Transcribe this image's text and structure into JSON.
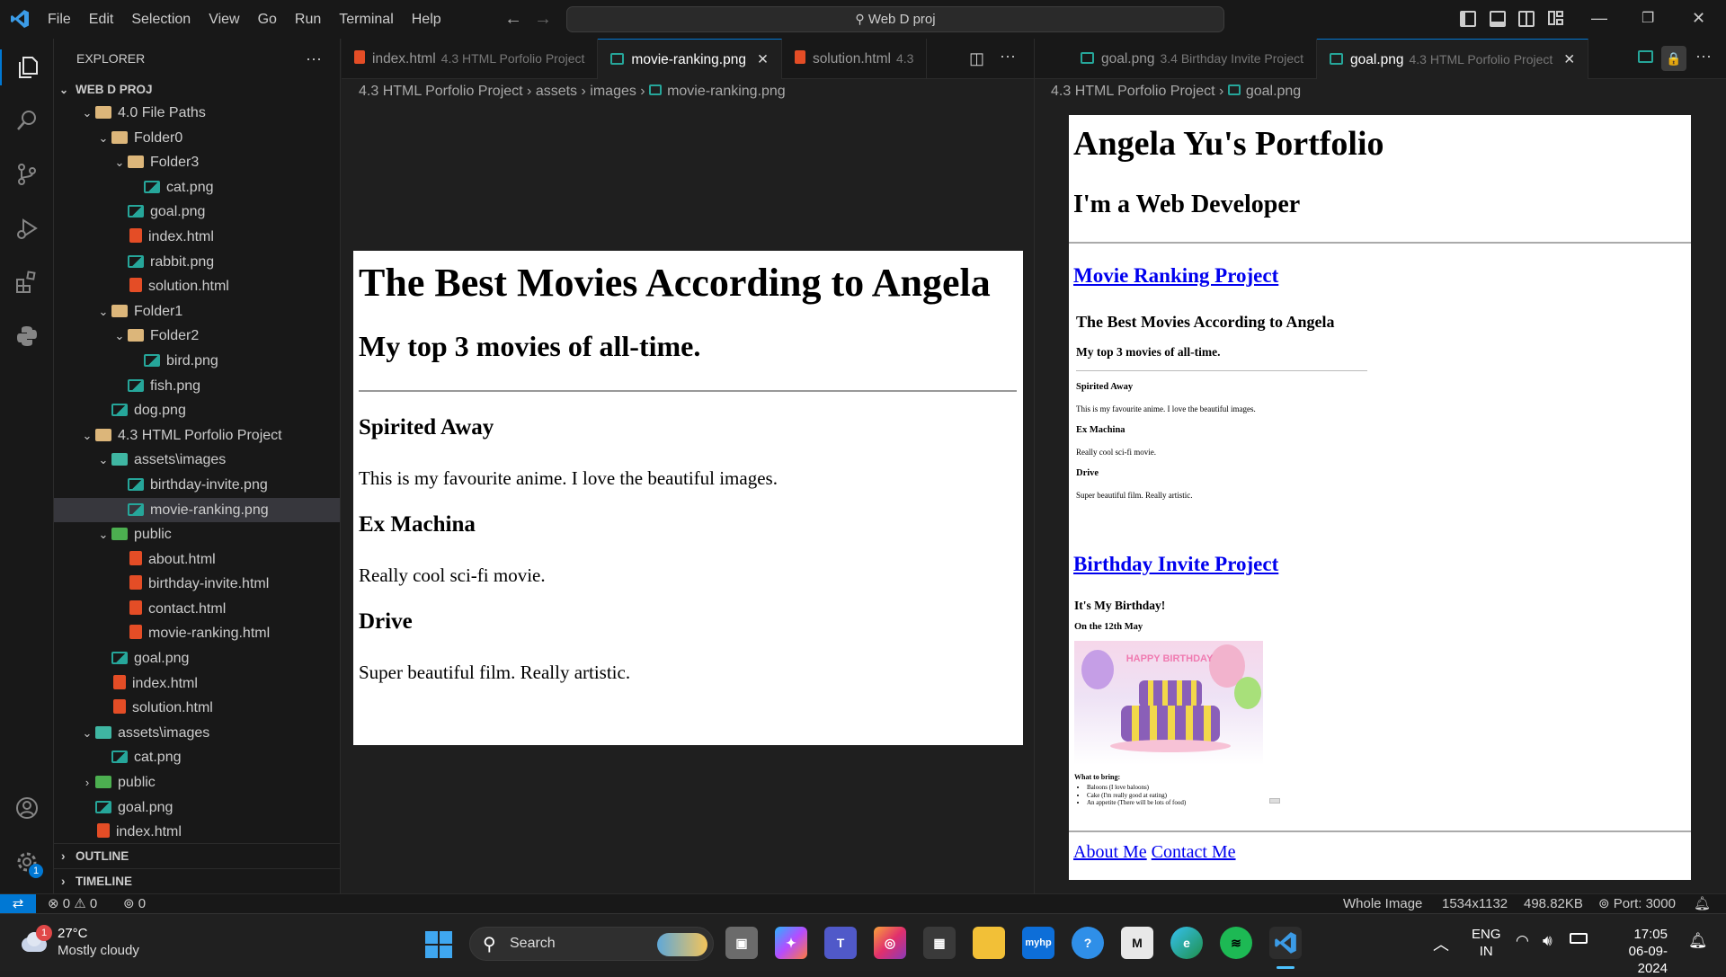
{
  "menu": [
    "File",
    "Edit",
    "Selection",
    "View",
    "Go",
    "Run",
    "Terminal",
    "Help"
  ],
  "search": {
    "label": "Web D proj"
  },
  "explorer": {
    "title": "EXPLORER",
    "root": "WEB D PROJ",
    "items": [
      {
        "label": "4.0 File Paths",
        "type": "folder",
        "depth": 1,
        "open": true
      },
      {
        "label": "Folder0",
        "type": "folder",
        "depth": 2,
        "open": true
      },
      {
        "label": "Folder3",
        "type": "folder",
        "depth": 3,
        "open": true
      },
      {
        "label": "cat.png",
        "type": "img",
        "depth": 4
      },
      {
        "label": "goal.png",
        "type": "img",
        "depth": 3
      },
      {
        "label": "index.html",
        "type": "html",
        "depth": 3
      },
      {
        "label": "rabbit.png",
        "type": "img",
        "depth": 3
      },
      {
        "label": "solution.html",
        "type": "html",
        "depth": 3
      },
      {
        "label": "Folder1",
        "type": "folder",
        "depth": 2,
        "open": true
      },
      {
        "label": "Folder2",
        "type": "folder",
        "depth": 3,
        "open": true
      },
      {
        "label": "bird.png",
        "type": "img",
        "depth": 4
      },
      {
        "label": "fish.png",
        "type": "img",
        "depth": 3
      },
      {
        "label": "dog.png",
        "type": "img",
        "depth": 2
      },
      {
        "label": "4.3 HTML Porfolio Project",
        "type": "folder",
        "depth": 1,
        "open": true
      },
      {
        "label": "assets\\images",
        "type": "folder-teal",
        "depth": 2,
        "open": true
      },
      {
        "label": "birthday-invite.png",
        "type": "img",
        "depth": 3
      },
      {
        "label": "movie-ranking.png",
        "type": "img",
        "depth": 3,
        "selected": true
      },
      {
        "label": "public",
        "type": "folder-green",
        "depth": 2,
        "open": true
      },
      {
        "label": "about.html",
        "type": "html",
        "depth": 3
      },
      {
        "label": "birthday-invite.html",
        "type": "html",
        "depth": 3
      },
      {
        "label": "contact.html",
        "type": "html",
        "depth": 3
      },
      {
        "label": "movie-ranking.html",
        "type": "html",
        "depth": 3
      },
      {
        "label": "goal.png",
        "type": "img",
        "depth": 2
      },
      {
        "label": "index.html",
        "type": "html",
        "depth": 2
      },
      {
        "label": "solution.html",
        "type": "html",
        "depth": 2
      },
      {
        "label": "assets\\images",
        "type": "folder-teal",
        "depth": 1,
        "open": true
      },
      {
        "label": "cat.png",
        "type": "img",
        "depth": 2
      },
      {
        "label": "public",
        "type": "folder-green",
        "depth": 1,
        "open": false
      },
      {
        "label": "goal.png",
        "type": "img",
        "depth": 1
      },
      {
        "label": "index.html",
        "type": "html",
        "depth": 1
      }
    ],
    "outline": "OUTLINE",
    "timeline": "TIMELINE"
  },
  "left_tabs": [
    {
      "label": "index.html",
      "desc": "4.3 HTML Porfolio Project",
      "icon": "html"
    },
    {
      "label": "movie-ranking.png",
      "desc": "",
      "icon": "img",
      "active": true
    },
    {
      "label": "solution.html",
      "desc": "4.3",
      "icon": "html"
    }
  ],
  "right_tabs": [
    {
      "label": "goal.png",
      "desc": "3.4 Birthday Invite Project",
      "icon": "img"
    },
    {
      "label": "goal.png",
      "desc": "4.3 HTML Porfolio Project",
      "icon": "img",
      "active": true
    }
  ],
  "left_crumbs": [
    "4.3 HTML Porfolio Project",
    "assets",
    "images",
    "movie-ranking.png"
  ],
  "right_crumbs": [
    "4.3 HTML Porfolio Project",
    "goal.png"
  ],
  "movie": {
    "title": "The Best Movies According to Angela",
    "subtitle": "My top 3 movies of all-time.",
    "movies": [
      {
        "name": "Spirited Away",
        "desc": "This is my favourite anime. I love the beautiful images."
      },
      {
        "name": "Ex Machina",
        "desc": "Really cool sci-fi movie."
      },
      {
        "name": "Drive",
        "desc": "Super beautiful film. Really artistic."
      }
    ]
  },
  "portfolio": {
    "title": "Angela Yu's Portfolio",
    "subtitle": "I'm a Web Developer",
    "project1_link": "Movie Ranking Project",
    "project2_link": "Birthday Invite Project",
    "bday_title": "It's My Birthday!",
    "bday_date": "On the 12th May",
    "cake_text": "HAPPY BIRTHDAY",
    "bring_title": "What to bring:",
    "bring_items": [
      "Baloons (I love baloons)",
      "Cake (I'm really good at eating)",
      "An appetite (There will be lots of food)"
    ],
    "footer_about": "About Me",
    "footer_contact": "Contact Me"
  },
  "status": {
    "errors": "0",
    "warnings": "0",
    "ports_count": "0",
    "zoom": "Whole Image",
    "dims": "1534x1132",
    "size": "498.82KB",
    "port": "Port: 3000"
  },
  "taskbar": {
    "weather_temp": "27°C",
    "weather_desc": "Mostly cloudy",
    "weather_badge": "1",
    "search": "Search",
    "lang1": "ENG",
    "lang2": "IN",
    "time": "17:05",
    "date": "06-09-2024"
  }
}
